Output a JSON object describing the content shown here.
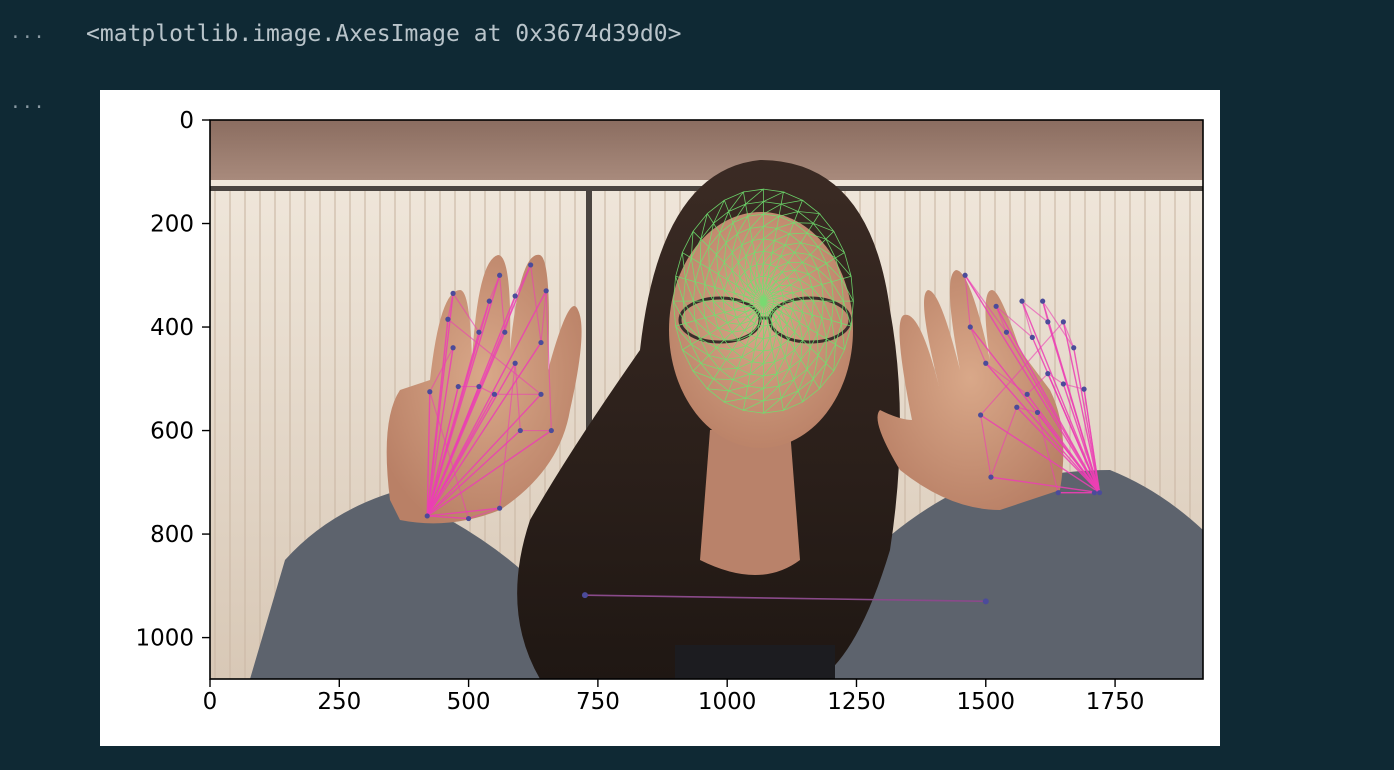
{
  "cell": {
    "output_collapse_1": "...",
    "output_collapse_2": "...",
    "repr_text": "<matplotlib.image.AxesImage at 0x3674d39d0>"
  },
  "colors": {
    "background": "#0f2934",
    "output_text": "#b9c4ca",
    "mesh": "#6fe06f",
    "hand_lines": "#ec3fb4",
    "landmark_points": "#4b4b9a"
  },
  "image_content": {
    "description_icon": "webcam-frame-with-face-mesh-and-hand-landmarks"
  },
  "chart_data": {
    "type": "image",
    "title": "",
    "xlabel": "",
    "ylabel": "",
    "xlim": [
      0,
      1920
    ],
    "ylim": [
      1080,
      0
    ],
    "x_ticks": [
      0,
      250,
      500,
      750,
      1000,
      1250,
      1500,
      1750
    ],
    "x_tick_labels": [
      "0",
      "250",
      "500",
      "750",
      "1000",
      "1250",
      "1500",
      "1750"
    ],
    "y_ticks": [
      0,
      200,
      400,
      600,
      800,
      1000
    ],
    "y_tick_labels": [
      "0",
      "200",
      "400",
      "600",
      "800",
      "1000"
    ],
    "grid": false,
    "left_hand_points": [
      [
        420,
        765
      ],
      [
        480,
        515
      ],
      [
        520,
        515
      ],
      [
        550,
        530
      ],
      [
        640,
        530
      ],
      [
        460,
        385
      ],
      [
        470,
        335
      ],
      [
        520,
        410
      ],
      [
        540,
        350
      ],
      [
        560,
        300
      ],
      [
        570,
        410
      ],
      [
        590,
        340
      ],
      [
        620,
        280
      ],
      [
        640,
        430
      ],
      [
        650,
        330
      ],
      [
        660,
        600
      ],
      [
        600,
        600
      ],
      [
        590,
        470
      ],
      [
        560,
        750
      ],
      [
        500,
        770
      ],
      [
        425,
        525
      ],
      [
        470,
        440
      ]
    ],
    "right_hand_points": [
      [
        1720,
        720
      ],
      [
        1690,
        520
      ],
      [
        1650,
        510
      ],
      [
        1620,
        490
      ],
      [
        1580,
        530
      ],
      [
        1500,
        470
      ],
      [
        1470,
        400
      ],
      [
        1460,
        300
      ],
      [
        1540,
        410
      ],
      [
        1520,
        360
      ],
      [
        1590,
        420
      ],
      [
        1570,
        350
      ],
      [
        1620,
        390
      ],
      [
        1610,
        350
      ],
      [
        1670,
        440
      ],
      [
        1650,
        390
      ],
      [
        1490,
        570
      ],
      [
        1510,
        690
      ],
      [
        1560,
        555
      ],
      [
        1600,
        565
      ],
      [
        1640,
        720
      ],
      [
        1710,
        720
      ]
    ],
    "pose_line": [
      [
        725,
        918
      ],
      [
        1500,
        930
      ]
    ],
    "face_center": [
      1070,
      350
    ]
  }
}
